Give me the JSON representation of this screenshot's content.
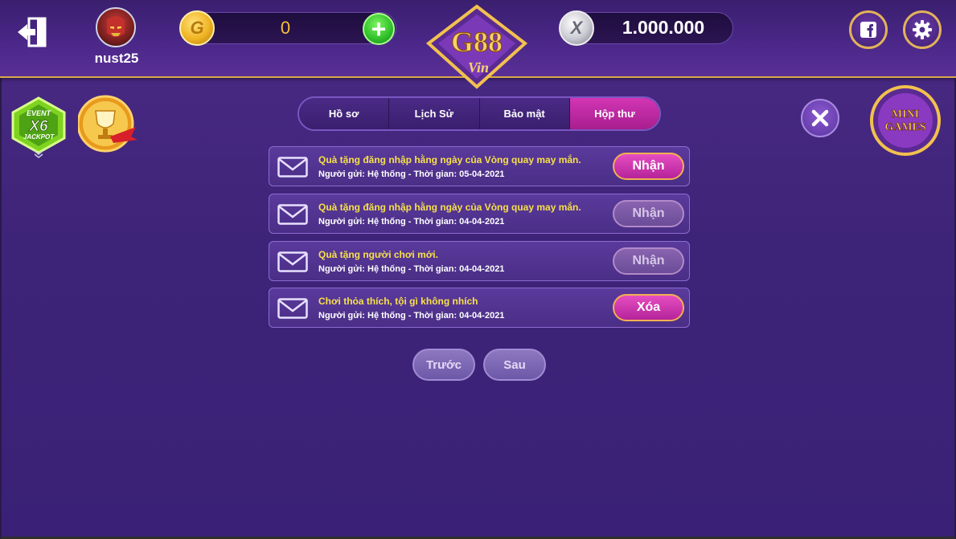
{
  "header": {
    "username": "nust25",
    "gold_balance": "0",
    "silver_balance": "1.000.000",
    "gold_coin_letter": "G",
    "silver_coin_letter": "X",
    "logo_text": "G88",
    "logo_subtext": "Vin"
  },
  "side": {
    "event_top": "EVENT",
    "event_mid": "X6",
    "event_bottom": "JACKPOT",
    "minigames_line1": "MINI",
    "minigames_line2": "GAMES"
  },
  "tabs": [
    {
      "label": "Hồ sơ",
      "active": false
    },
    {
      "label": "Lịch Sử",
      "active": false
    },
    {
      "label": "Bảo mật",
      "active": false
    },
    {
      "label": "Hộp thư",
      "active": true
    }
  ],
  "mails": [
    {
      "title": "Quà tặng đăng nhập hằng ngày của Vòng quay may mắn.",
      "meta": "Người gửi: Hệ thống - Thời gian: 05-04-2021",
      "action": "Nhận",
      "enabled": true
    },
    {
      "title": "Quà tặng đăng nhập hằng ngày của Vòng quay may mắn.",
      "meta": "Người gửi: Hệ thống - Thời gian: 04-04-2021",
      "action": "Nhận",
      "enabled": false
    },
    {
      "title": "Quà tặng người chơi mới.",
      "meta": "Người gửi: Hệ thống - Thời gian: 04-04-2021",
      "action": "Nhận",
      "enabled": false
    },
    {
      "title": "Chơi thỏa thích, tội gì không nhích",
      "meta": "Người gửi: Hệ thống - Thời gian: 04-04-2021",
      "action": "Xóa",
      "enabled": true
    }
  ],
  "pagination": {
    "prev": "Trước",
    "next": "Sau"
  },
  "colors": {
    "accent_pink": "#d235b4",
    "gold": "#f5c03a",
    "title_yellow": "#f7e04a",
    "background": "#3e2478"
  }
}
